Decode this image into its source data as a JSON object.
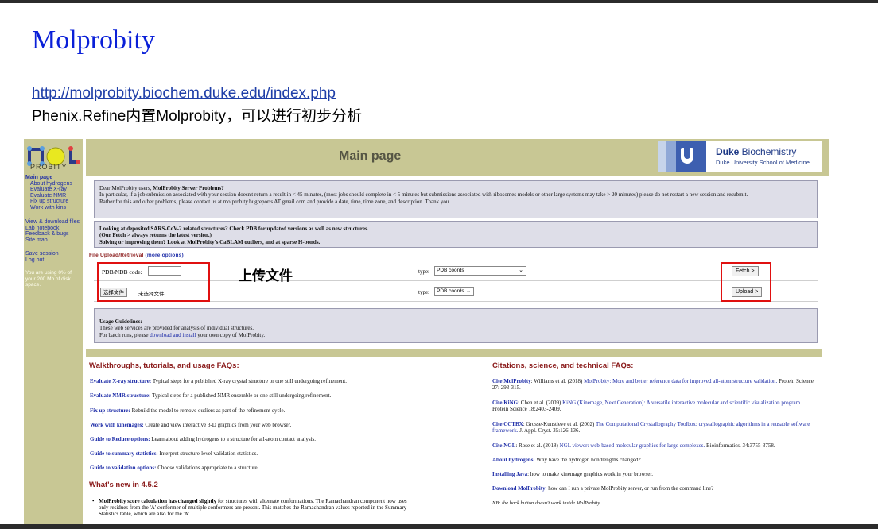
{
  "slide": {
    "title": "Molprobity",
    "link": "http://molprobity.biochem.duke.edu/index.php",
    "subtitle": "Phenix.Refine内置Molprobity，可以进行初步分析",
    "annotation_label": "上传文件",
    "annotation_color": "#e01010"
  },
  "app": {
    "logo_text": "PROBITY",
    "header_title": "Main page",
    "duke_name_bold": "Duke",
    "duke_name_rest": " Biochemistry",
    "duke_school": "Duke University School of Medicine"
  },
  "sidebar": {
    "group1": [
      {
        "label": "Main page",
        "indent": false
      },
      {
        "label": "About hydrogens",
        "indent": true
      },
      {
        "label": "Evaluate X-ray",
        "indent": true
      },
      {
        "label": "Evaluate NMR",
        "indent": true
      },
      {
        "label": "Fix up structure",
        "indent": true
      },
      {
        "label": "Work with kins",
        "indent": true
      }
    ],
    "group2": [
      "View & download files",
      "Lab notebook",
      "Feedback & bugs",
      "Site map"
    ],
    "group3": [
      "Save session",
      "Log out"
    ],
    "usage_note": "You are using 0% of your 200 Mb of disk space."
  },
  "notices": {
    "server": {
      "intro": "Dear MolProbity users, ",
      "bold": "MolProbity Server Problems?",
      "line2": "In particular, if a job submission associated with your session doesn't return a result in < 45 minutes, (most jobs should complete in < 5 minutes but submissions associated with ribosomes models or other large systems may take > 20 minutes) please do not restart a new session and resubmit.",
      "line3": "Rather for this and other problems, please contact us at molprobity.bugreports AT gmail.com and provide a date, time, time zone, and description. Thank you."
    },
    "covid": {
      "line1": "Looking at deposited SARS-CoV-2 related structures? Check PDB for updated versions as well as new structures.",
      "line2": "(Our Fetch > always returns the latest version.)",
      "line3": "Solving or improving them? Look at MolProbity's CaBLAM outliers, and at sparse H-bonds."
    },
    "usage": {
      "title": "Usage Guidelines:",
      "line1": "These web services are provided for analysis of individual structures.",
      "line2_pre": "For batch runs, please ",
      "line2_link": "download and install",
      "line2_post": " your own copy of MolProbity."
    }
  },
  "upload": {
    "section_title": "File Upload/Retrieval",
    "more_options": "(more options)",
    "pdb_label": "PDB/NDB code:",
    "pdb_value": "",
    "type_label": "type:",
    "fetch_type": "PDB coords",
    "fetch_button": "Fetch >",
    "file_button": "选择文件",
    "file_status": "未选择文件",
    "upload_type": "PDB coords",
    "upload_button": "Upload >"
  },
  "left_column": {
    "title": "Walkthroughs, tutorials, and usage FAQs:",
    "items": [
      {
        "key": "Evaluate X-ray structure:",
        "text": " Typical steps for a published X-ray crystal structure or one still undergoing refinement."
      },
      {
        "key": "Evaluate NMR structure:",
        "text": " Typical steps for a published NMR ensemble or one still undergoing refinement."
      },
      {
        "key": "Fix up structure:",
        "text": " Rebuild the model to remove outliers as part of the refinement cycle."
      },
      {
        "key": "Work with kinemages:",
        "text": " Create and view interactive 3-D graphics from your web browser."
      },
      {
        "key": "Guide to Reduce options:",
        "text": " Learn about adding hydrogens to a structure for all-atom contact analysis."
      },
      {
        "key": "Guide to summary statistics:",
        "text": " Interpret structure-level validation statistics."
      },
      {
        "key": "Guide to validation options:",
        "text": " Choose validations appropriate to a structure."
      }
    ],
    "whats_new_title": "What's new in 4.5.2",
    "whats_new_bold": "MolProbity score calculation has changed slightly",
    "whats_new_text": " for structures with alternate conformations. The Ramachandran component now uses only residues from the 'A' conformer of multiple conformers are present. This matches the Ramachandran values reported in the Summary Statistics table, which are also for the 'A'"
  },
  "right_column": {
    "title": "Citations, science, and technical FAQs:",
    "citations": [
      {
        "key": "Cite MolProbity",
        "pre": ": Williams et al. (2018) ",
        "link": "MolProbity: More and better reference data for improved all-atom structure validation.",
        "post": " Protein Science 27: 293-315."
      },
      {
        "key": "Cite KiNG",
        "pre": ": Chen et al. (2009) ",
        "link": "KiNG (Kinemage, Next Generation): A versatile interactive molecular and scientific visualization program.",
        "post": " Protein Science 18:2403-2409."
      },
      {
        "key": "Cite CCTBX",
        "pre": ": Grosse-Kunstleve et al. (2002) ",
        "link": "The Computational Crystallography Toolbox: crystallographic algorithms in a reusable software framework.",
        "post": " J. Appl. Cryst. 35:126-136."
      },
      {
        "key": "Cite NGL",
        "pre": ": Rose et al. (2018) ",
        "link": "NGL viewer: web-based molecular graphics for large complexes.",
        "post": " Bioinformatics. 34:3755-3758."
      }
    ],
    "faqs": [
      {
        "key": "About hydrogens:",
        "text": " Why have the hydrogen bondlengths changed?"
      },
      {
        "key": "Installing Java",
        "text": ": how to make kinemage graphics work in your browser."
      },
      {
        "key": "Download MolProbity",
        "text": ": how can I run a private MolProbity server, or run from the command line?"
      }
    ],
    "note": "NB: the back button doesn't work inside MolProbity"
  }
}
